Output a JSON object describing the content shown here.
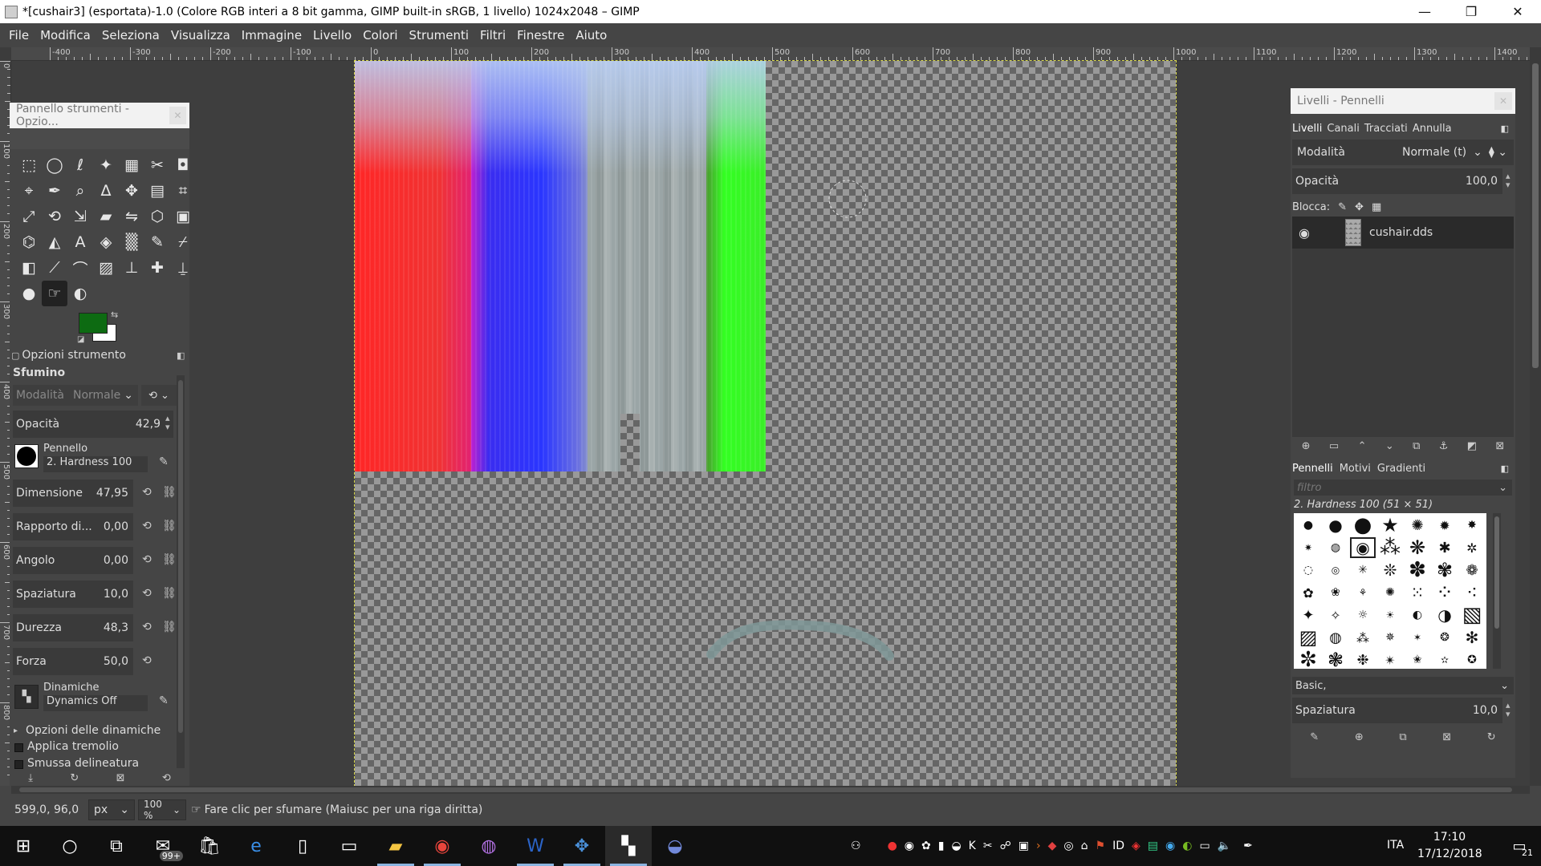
{
  "window": {
    "title": "*[cushair3] (esportata)-1.0 (Colore RGB interi a 8 bit gamma, GIMP built-in sRGB, 1 livello) 1024x2048 – GIMP",
    "minimize": "—",
    "maximize": "❐",
    "close": "✕"
  },
  "menu": [
    "File",
    "Modifica",
    "Seleziona",
    "Visualizza",
    "Immagine",
    "Livello",
    "Colori",
    "Strumenti",
    "Filtri",
    "Finestre",
    "Aiuto"
  ],
  "ruler": {
    "h_labels": [
      "-400",
      "-300",
      "-200",
      "-100",
      "0",
      "100",
      "200",
      "300",
      "400",
      "500",
      "600",
      "700",
      "800",
      "900",
      "1000",
      "1100",
      "1200",
      "1300",
      "1400"
    ],
    "v_labels": [
      "0",
      "100",
      "200",
      "300",
      "400",
      "500",
      "600",
      "700",
      "800"
    ]
  },
  "toolbox": {
    "title": "Pannello strumenti - Opzio...",
    "tool_options_header": "Opzioni strumento",
    "tool_name": "Sfumino",
    "mode_label": "Modalità",
    "mode_value": "Normale",
    "opacity_label": "Opacità",
    "opacity_value": "42,9",
    "brush_label": "Pennello",
    "brush_value": "2. Hardness 100",
    "size_label": "Dimensione",
    "size_value": "47,95",
    "ratio_label": "Rapporto di...",
    "ratio_value": "0,00",
    "angle_label": "Angolo",
    "angle_value": "0,00",
    "spacing_label": "Spaziatura",
    "spacing_value": "10,0",
    "hardness_label": "Durezza",
    "hardness_value": "48,3",
    "force_label": "Forza",
    "force_value": "50,0",
    "dynamics_label": "Dinamiche",
    "dynamics_value": "Dynamics Off",
    "dyn_options": "Opzioni delle dinamiche",
    "apply_jitter": "Applica tremolio",
    "smooth_stroke": "Smussa delineatura",
    "fg_color": "#0d6b12",
    "bg_color": "#ffffff"
  },
  "layers": {
    "title": "Livelli - Pennelli",
    "tabs": [
      "Livelli",
      "Canali",
      "Tracciati",
      "Annulla"
    ],
    "mode_label": "Modalità",
    "mode_value": "Normale (t)",
    "opacity_label": "Opacità",
    "opacity_value": "100,0",
    "lock_label": "Blocca:",
    "layer_name": "cushair.dds"
  },
  "brushes": {
    "tabs": [
      "Pennelli",
      "Motivi",
      "Gradienti"
    ],
    "filter_placeholder": "filtro",
    "selected": "2. Hardness 100 (51 × 51)",
    "tag_value": "Basic,",
    "spacing_label": "Spaziatura",
    "spacing_value": "10,0"
  },
  "status": {
    "coords": "599,0, 96,0",
    "unit": "px",
    "zoom": "100 %",
    "message": "Fare clic per sfumare (Maiusc per una riga diritta)"
  },
  "taskbar": {
    "badge": "99+",
    "lang": "ITA",
    "time": "17:10",
    "date": "17/12/2018",
    "notif": "21"
  },
  "colors": {
    "red": "#ff2a2a",
    "blue": "#2a2aff",
    "green": "#33ff22",
    "grey": "#9aa3a4",
    "lightblue": "#b8cdf2"
  }
}
